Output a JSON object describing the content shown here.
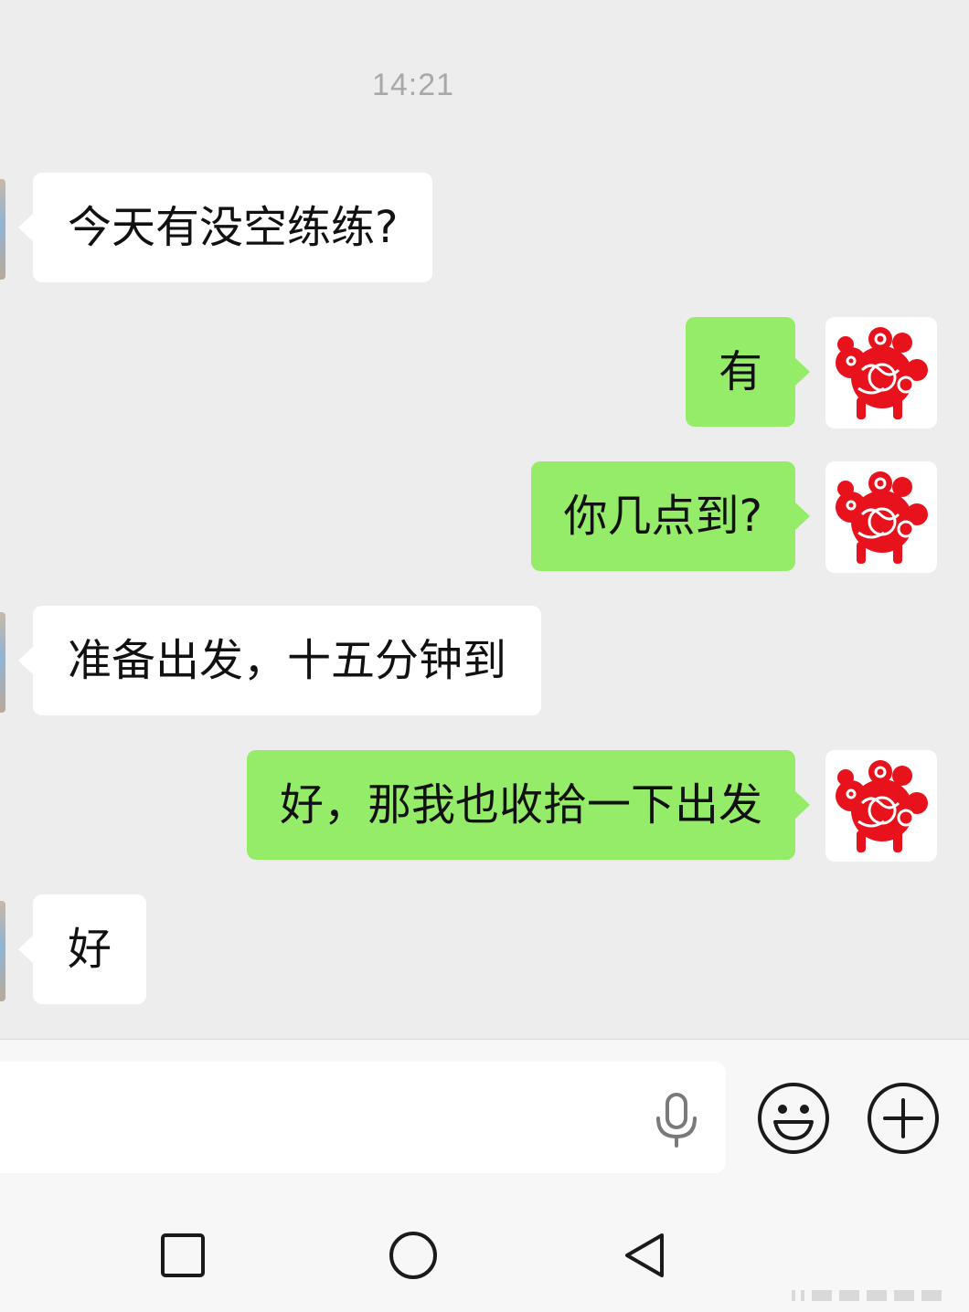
{
  "chat": {
    "timestamp": "14:21",
    "messages": [
      {
        "sender": "peer",
        "text": "今天有没空练练?"
      },
      {
        "sender": "me",
        "text": "有"
      },
      {
        "sender": "me",
        "text": "你几点到?"
      },
      {
        "sender": "peer",
        "text": "准备出发，十五分钟到"
      },
      {
        "sender": "me",
        "text": "好，那我也收拾一下出发"
      },
      {
        "sender": "peer",
        "text": "好"
      }
    ]
  },
  "colors": {
    "chat_background": "#ededed",
    "outgoing_bubble": "#95ec69",
    "incoming_bubble": "#ffffff",
    "avatar_papercut_red": "#e8121c"
  },
  "input_bar": {
    "text_value": "",
    "icons": [
      "microphone-icon",
      "emoji-icon",
      "plus-icon"
    ]
  },
  "nav_bar": {
    "icons": [
      "recent-apps-icon",
      "home-icon",
      "back-icon"
    ]
  }
}
